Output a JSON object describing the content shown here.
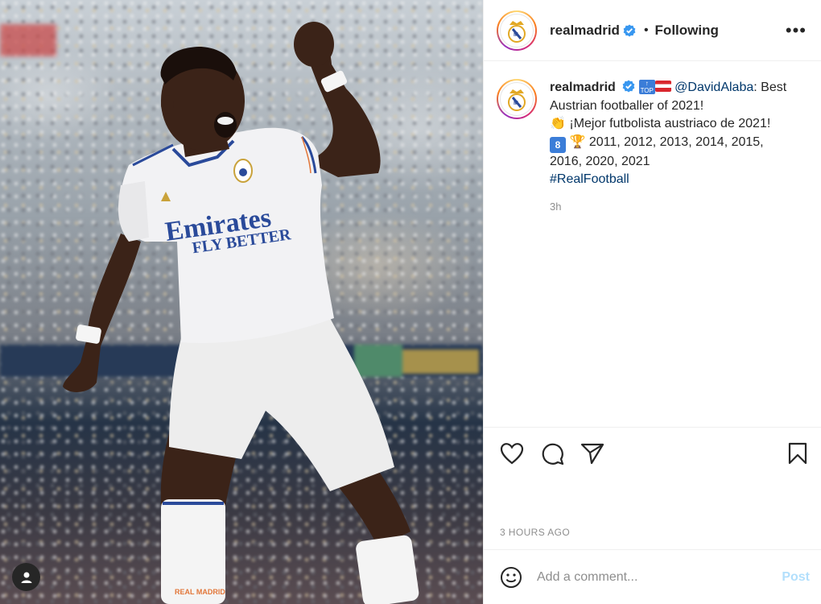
{
  "post": {
    "username": "realmadrid",
    "follow_status": "Following",
    "more_label": "•••",
    "caption": {
      "username": "realmadrid",
      "badge_top": "TOP",
      "mention": "@DavidAlaba",
      "line1": ": Best Austrian footballer of 2021!",
      "line2": "¡Mejor futbolista austriaco de 2021!",
      "badge_8": "8",
      "years": "2011, 2012, 2013, 2014, 2015, 2016, 2020, 2021",
      "hashtag": "#RealFootball"
    },
    "relative_time": "3h",
    "timestamp": "3 HOURS AGO"
  },
  "jersey": {
    "sponsor_line1": "Emirates",
    "sponsor_line2": "FLY BETTER",
    "shorts_text": "REAL MADRID"
  },
  "comment": {
    "placeholder": "Add a comment...",
    "post_label": "Post"
  },
  "colors": {
    "accent_link": "#00376b",
    "post_disabled": "#b2dffc",
    "verified": "#3897f0"
  },
  "icons": [
    "heart-icon",
    "comment-icon",
    "share-icon",
    "save-icon",
    "emoji-icon",
    "verified-icon",
    "more-icon",
    "user-icon"
  ]
}
